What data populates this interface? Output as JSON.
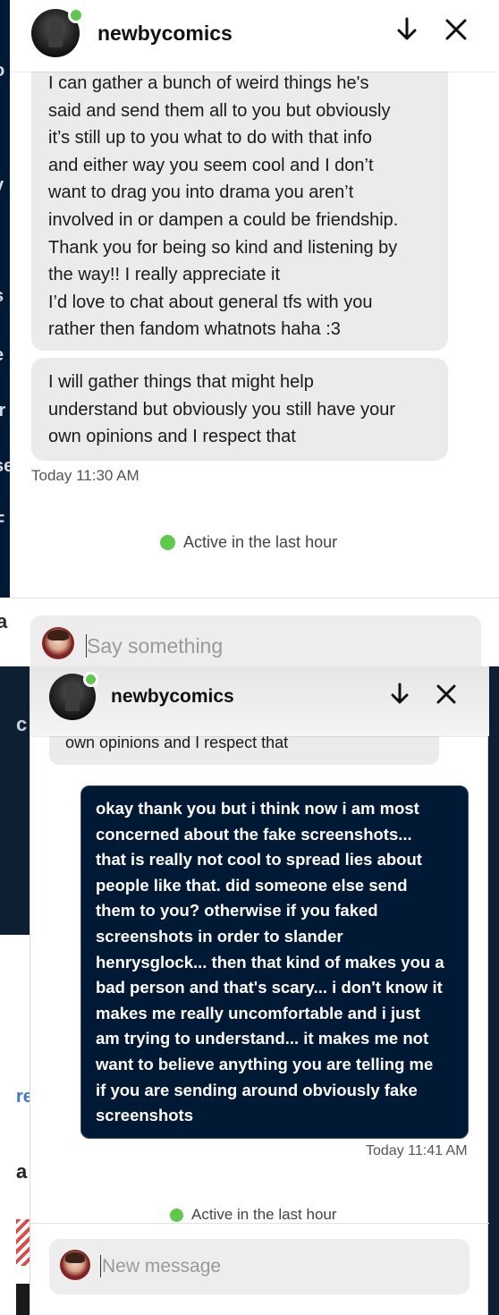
{
  "theme": {
    "accent_online": "#5fc84f",
    "sent_bubble": "#001935",
    "received_bubble": "#ebebeb"
  },
  "top_panel": {
    "header": {
      "name": "newbycomics",
      "avatar_icon": "blog-avatar",
      "status_icon": "online-dot-icon",
      "minimize_icon": "arrow-down-icon",
      "close_icon": "close-icon"
    },
    "background_letters": [
      "o",
      "v",
      "t",
      "s",
      "e",
      "Ir",
      "se",
      "F"
    ],
    "background_bottom_letter": "a",
    "messages": [
      {
        "text": "I can gather a bunch of weird things he's\nsaid and send them all to you but obviously\nit’s still up to you what to do with that info\nand either way you seem cool and I don’t\nwant to drag you into drama you aren’t\ninvolved in or dampen a could be friendship.\nThank you for being so kind and listening by\nthe way!! I really appreciate it\nI’d love to chat about general tfs with you\nrather then fandom whatnots haha :3"
      },
      {
        "text": "I will gather things that might help\nunderstand but obviously you still have your\nown opinions and I respect that"
      }
    ],
    "timestamp": "Today 11:30 AM",
    "active_status": "Active in the last hour",
    "composer": {
      "placeholder": "Say something",
      "avatar_icon": "user-avatar"
    }
  },
  "bottom_panel": {
    "header": {
      "name": "newbycomics",
      "avatar_icon": "blog-avatar",
      "status_icon": "online-dot-icon",
      "minimize_icon": "arrow-down-icon",
      "close_icon": "close-icon"
    },
    "background_letters": [
      "c",
      "re",
      "a"
    ],
    "partial_message": "own opinions and I respect that",
    "sent_message": "okay thank you but i think now i am most\nconcerned about the fake screenshots...\nthat is really not cool to spread lies about\npeople like that. did someone else send\nthem to you? otherwise if you faked\nscreenshots in order to slander\nhenrysglock... then that kind of makes you a\nbad person and that's scary... i don't know it\nmakes me really uncomfortable and i just\nam trying to understand... it makes me not\nwant to believe anything you are telling me\nif you are sending around obviously fake\nscreenshots",
    "timestamp": "Today 11:41 AM",
    "active_status": "Active in the last hour",
    "composer": {
      "placeholder": "New message",
      "avatar_icon": "user-avatar"
    }
  }
}
